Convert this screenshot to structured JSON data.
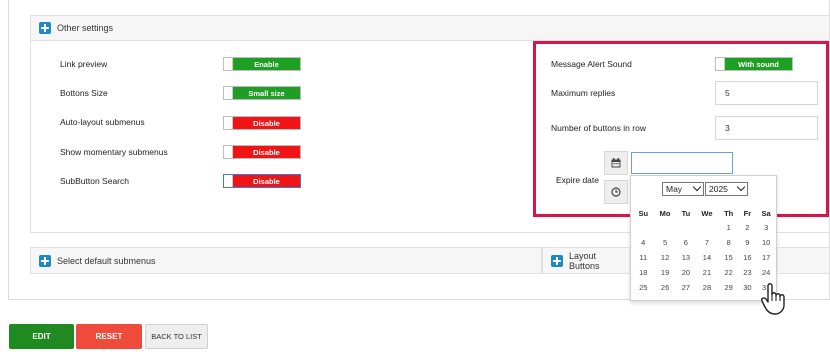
{
  "other_settings": {
    "title": "Other settings"
  },
  "left_settings": [
    {
      "label": "Link preview",
      "value": "Enable",
      "color": "#1f9e24"
    },
    {
      "label": "Bottons Size",
      "value": "Small size",
      "color": "#1f9e24"
    },
    {
      "label": "Auto-layout submenus",
      "value": "Disable",
      "color": "#f01414"
    },
    {
      "label": "Show momentary submenus",
      "value": "Disable",
      "color": "#f01414"
    },
    {
      "label": "SubButton Search",
      "value": "Disable",
      "color": "#f01414"
    }
  ],
  "right_settings": {
    "alert_sound": {
      "label": "Message Alert Sound",
      "value": "With sound"
    },
    "max_replies": {
      "label": "Maximum replies",
      "value": "5"
    },
    "buttons_in_row": {
      "label": "Number of buttons in row",
      "value": "3"
    },
    "expire_date": {
      "label": "Expire date",
      "value": ""
    }
  },
  "datepicker": {
    "month": "May",
    "year": "2025",
    "weekdays": [
      "Su",
      "Mo",
      "Tu",
      "We",
      "Th",
      "Fr",
      "Sa"
    ],
    "weeks": [
      [
        "",
        "",
        "",
        "",
        "1",
        "2",
        "3"
      ],
      [
        "4",
        "5",
        "6",
        "7",
        "8",
        "9",
        "10"
      ],
      [
        "11",
        "12",
        "13",
        "14",
        "15",
        "16",
        "17"
      ],
      [
        "18",
        "19",
        "20",
        "21",
        "22",
        "23",
        "24"
      ],
      [
        "25",
        "26",
        "27",
        "28",
        "29",
        "30",
        "31"
      ]
    ]
  },
  "sections": {
    "default_submenus": "Select default submenus",
    "layout_buttons": "Layout Buttons"
  },
  "actions": {
    "edit": "EDIT",
    "reset": "RESET",
    "back": "BACK TO LIST"
  },
  "colors": {
    "accent": "#1e88c8",
    "highlight": "#d6154a",
    "enable": "#1f9e24",
    "disable": "#f01414"
  }
}
